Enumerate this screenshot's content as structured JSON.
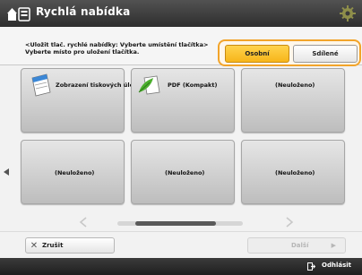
{
  "title_bar": {
    "title": "Rychlá nabídka"
  },
  "header": {
    "info_text": "<Uložit tlač. rychlé nabídky: Vyberte umístění tlačítka> Vyberte místo pro uložení tlačítka."
  },
  "toggle": {
    "active_label": "Osobní",
    "inactive_label": "Sdílené",
    "highlight_color": "#f2a42a"
  },
  "tiles": [
    {
      "label": "Zobrazení tiskových úloh",
      "icon": "document-icon"
    },
    {
      "label": "PDF (Kompakt)",
      "icon": "leaf-document-icon"
    },
    {
      "label": "(Neuloženo)"
    },
    {
      "label": "(Neuloženo)"
    },
    {
      "label": "(Neuloženo)"
    },
    {
      "label": "(Neuloženo)"
    }
  ],
  "bottom": {
    "delete_label": "Zrušit",
    "next_label": "Další"
  },
  "status_bar": {
    "label": "Odhlásit"
  }
}
